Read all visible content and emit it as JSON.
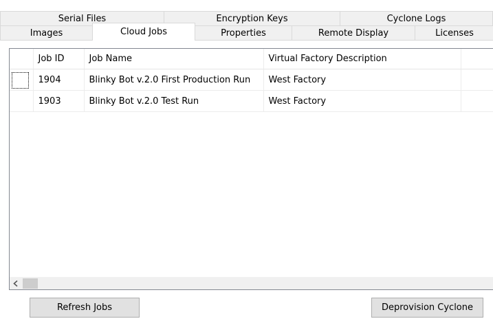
{
  "tabs": {
    "back_row": [
      {
        "label": "Serial Files"
      },
      {
        "label": "Encryption Keys"
      },
      {
        "label": "Cyclone Logs"
      }
    ],
    "front_row": [
      {
        "label": "Images"
      },
      {
        "label": "Cloud Jobs"
      },
      {
        "label": "Properties"
      },
      {
        "label": "Remote Display"
      },
      {
        "label": "Licenses"
      }
    ],
    "selected": "Cloud Jobs"
  },
  "jobs_table": {
    "columns": [
      "Job ID",
      "Job Name",
      "Virtual Factory Description"
    ],
    "rows": [
      {
        "job_id": "1904",
        "job_name": "Blinky Bot v.2.0 First Production Run",
        "factory": "West Factory"
      },
      {
        "job_id": "1903",
        "job_name": "Blinky Bot v.2.0 Test Run",
        "factory": "West Factory"
      }
    ]
  },
  "scrollbar": {
    "left_arrow_icon": "chevron-left-icon"
  },
  "buttons": {
    "refresh_label": "Refresh Jobs",
    "deprovision_label": "Deprovision Cyclone"
  },
  "colors": {
    "window_background": "#ffffff",
    "tab_background": "#f0f0f0",
    "button_background": "#e1e1e1",
    "button_border": "#adadad"
  }
}
